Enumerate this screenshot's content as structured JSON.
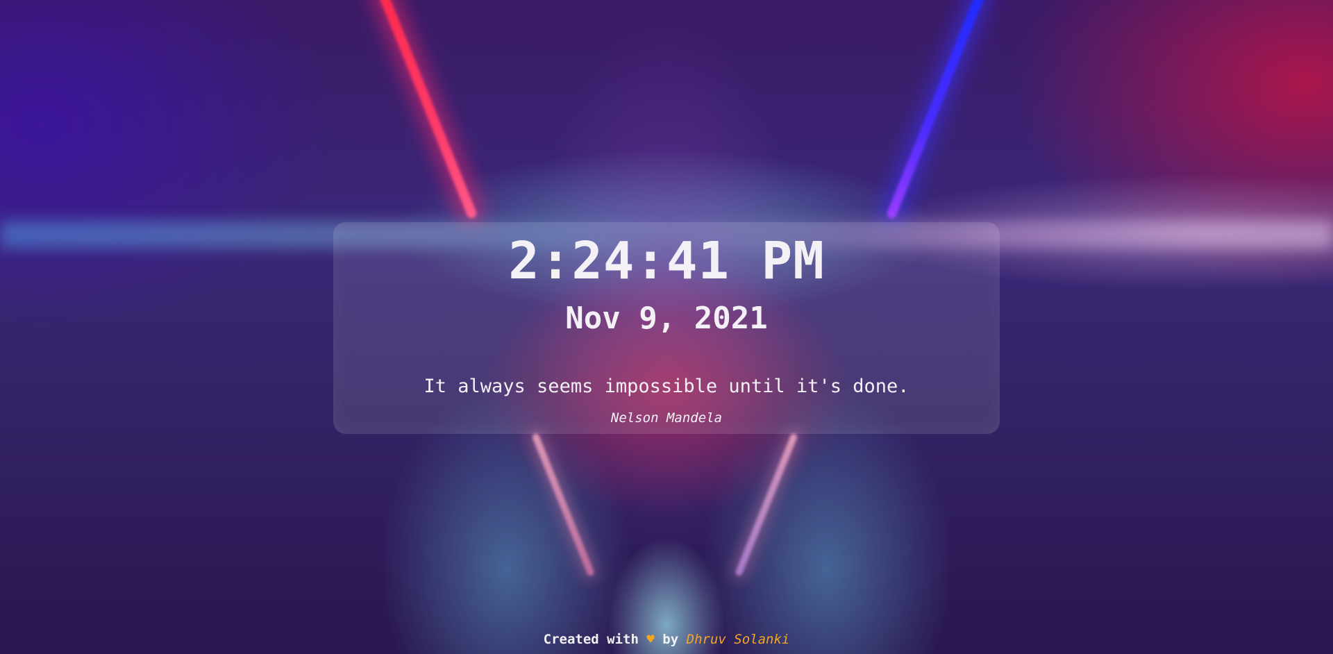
{
  "clock": {
    "time": "2:24:41 PM",
    "date": "Nov 9, 2021"
  },
  "quote": {
    "text": "It always seems impossible until it's done.",
    "author": "Nelson Mandela"
  },
  "footer": {
    "prefix": "Created with",
    "heart": "♥",
    "middle": "by",
    "author_name": "Dhruv Solanki"
  },
  "colors": {
    "accent": "#f5a623",
    "text": "#f4f1f6"
  },
  "icons": {
    "heart": "heart-icon"
  }
}
